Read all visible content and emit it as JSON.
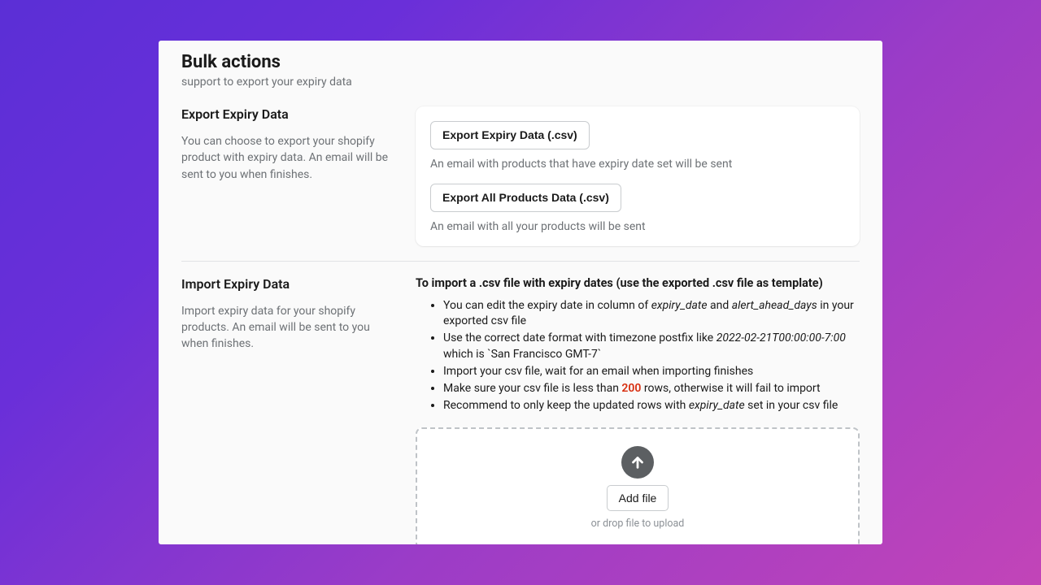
{
  "header": {
    "title": "Bulk actions",
    "subtitle": "support to export your expiry data"
  },
  "export": {
    "side_title": "Export Expiry Data",
    "side_desc": "You can choose to export your shopify product with expiry data. An email will be sent to you when finishes.",
    "btn1": "Export Expiry Data (.csv)",
    "hint1": "An email with products that have expiry date set will be sent",
    "btn2": "Export All Products Data (.csv)",
    "hint2": "An email with all your products will be sent"
  },
  "import": {
    "side_title": "Import Expiry Data",
    "side_desc": "Import expiry data for your shopify products. An email will be sent to you when finishes.",
    "heading": "To import a .csv file with expiry dates (use the exported .csv file as template)",
    "li1_a": "You can edit the expiry date in column of ",
    "li1_col1": "expiry_date",
    "li1_b": " and ",
    "li1_col2": "alert_ahead_days",
    "li1_c": " in your exported csv file",
    "li2_a": "Use the correct date format with timezone postfix like ",
    "li2_ex": "2022-02-21T00:00:00-7:00",
    "li2_b": " which is `San Francisco GMT-7`",
    "li3": "Import your csv file, wait for an email when importing finishes",
    "li4_a": "Make sure your csv file is less than ",
    "li4_num": "200",
    "li4_b": " rows, otherwise it will fail to import",
    "li5_a": "Recommend to only keep the updated rows with ",
    "li5_col": "expiry_date",
    "li5_b": " set in your csv file",
    "add_file": "Add file",
    "drop_hint": "or drop file to upload"
  }
}
